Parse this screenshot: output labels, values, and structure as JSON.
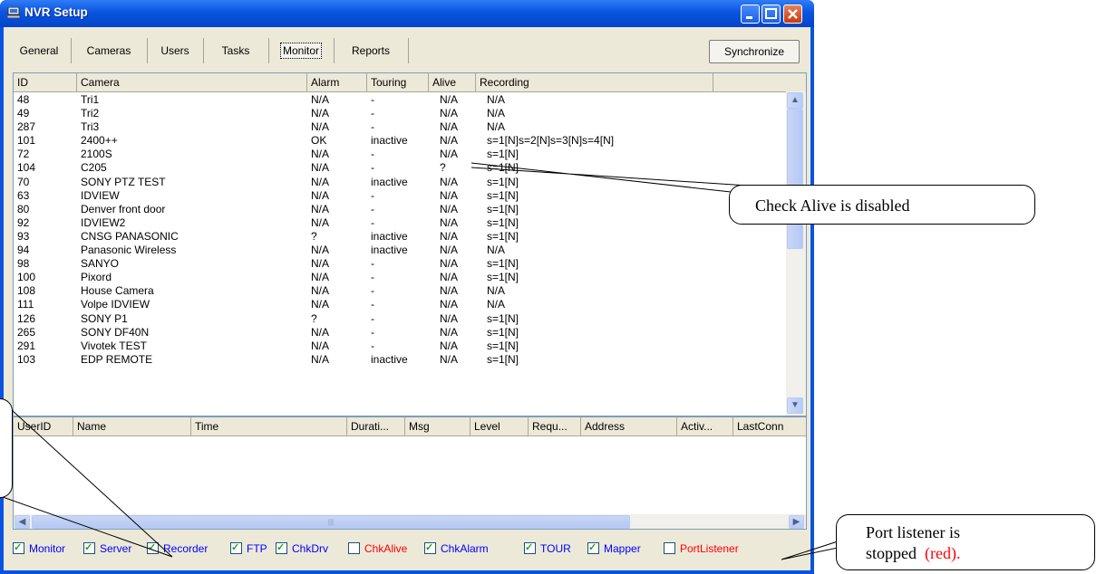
{
  "window": {
    "title": "NVR Setup",
    "icon": "computer-icon"
  },
  "tabs": [
    "General",
    "Cameras",
    "Users",
    "Tasks",
    "Monitor",
    "Reports"
  ],
  "active_tab": "Monitor",
  "sync_button": "Synchronize",
  "camera_table": {
    "columns": [
      "ID",
      "Camera",
      "Alarm",
      "Touring",
      "Alive",
      "Recording"
    ],
    "rows": [
      [
        "48",
        "Tri1",
        "N/A",
        "-",
        "N/A",
        "N/A"
      ],
      [
        "49",
        "Tri2",
        "N/A",
        "-",
        "N/A",
        "N/A"
      ],
      [
        "287",
        "Tri3",
        "N/A",
        "-",
        "N/A",
        "N/A"
      ],
      [
        "101",
        "2400++",
        "OK",
        "inactive",
        "N/A",
        "s=1[N]s=2[N]s=3[N]s=4[N]"
      ],
      [
        "72",
        "2100S",
        "N/A",
        "-",
        "N/A",
        "s=1[N]"
      ],
      [
        "104",
        "C205",
        "N/A",
        "-",
        "?",
        "s=1[N]"
      ],
      [
        "70",
        "SONY PTZ TEST",
        "N/A",
        "inactive",
        "N/A",
        "s=1[N]"
      ],
      [
        "63",
        "IDVIEW",
        "N/A",
        "-",
        "N/A",
        "s=1[N]"
      ],
      [
        "80",
        "Denver front door",
        "N/A",
        "-",
        "N/A",
        "s=1[N]"
      ],
      [
        "92",
        "IDVIEW2",
        "N/A",
        "-",
        "N/A",
        "s=1[N]"
      ],
      [
        "93",
        "CNSG PANASONIC",
        "?",
        "inactive",
        "N/A",
        "s=1[N]"
      ],
      [
        "94",
        "Panasonic Wireless",
        "N/A",
        "inactive",
        "N/A",
        "N/A"
      ],
      [
        "98",
        "SANYO",
        "N/A",
        "-",
        "N/A",
        "s=1[N]"
      ],
      [
        "100",
        "Pixord",
        "N/A",
        "-",
        "N/A",
        "s=1[N]"
      ],
      [
        "108",
        "House Camera",
        "N/A",
        "-",
        "N/A",
        "N/A"
      ],
      [
        "111",
        "Volpe IDVIEW",
        "N/A",
        "-",
        "N/A",
        "N/A"
      ],
      [
        "126",
        "SONY P1",
        "?",
        "-",
        "N/A",
        "s=1[N]"
      ],
      [
        "265",
        "SONY DF40N",
        "N/A",
        "-",
        "N/A",
        "s=1[N]"
      ],
      [
        "291",
        "Vivotek TEST",
        "N/A",
        "-",
        "N/A",
        "s=1[N]"
      ],
      [
        "103",
        "EDP REMOTE",
        "N/A",
        "inactive",
        "N/A",
        "s=1[N]"
      ]
    ]
  },
  "user_table": {
    "columns": [
      "UserID",
      "Name",
      "Time",
      "Durati...",
      "Msg",
      "Level",
      "Requ...",
      "Address",
      "Activ...",
      "LastConn"
    ]
  },
  "status_checks": [
    {
      "label": "Monitor",
      "checked": true,
      "color": "#0000ff"
    },
    {
      "label": "Server",
      "checked": true,
      "color": "#0000ff"
    },
    {
      "label": "Recorder",
      "checked": true,
      "color": "#0000ff"
    },
    {
      "label": "FTP",
      "checked": true,
      "color": "#0000ff"
    },
    {
      "label": "ChkDrv",
      "checked": true,
      "color": "#0000ff"
    },
    {
      "label": "ChkAlive",
      "checked": false,
      "color": "#ff0000"
    },
    {
      "label": "ChkAlarm",
      "checked": true,
      "color": "#0000ff"
    },
    {
      "label": "TOUR",
      "checked": true,
      "color": "#0000ff"
    },
    {
      "label": "Mapper",
      "checked": true,
      "color": "#0000ff"
    },
    {
      "label": "PortListener",
      "checked": false,
      "color": "#ff0000"
    }
  ],
  "callouts": {
    "check_alive": "Check Alive is disabled",
    "port_listener_line1": "Port listener is",
    "port_listener_line2": "stopped",
    "port_listener_red": "(red)."
  },
  "colors": {
    "title_bar": "#0a55df",
    "window_bg": "#ece9d8",
    "ok_blue": "#0000ff",
    "stopped_red": "#ff0000"
  }
}
